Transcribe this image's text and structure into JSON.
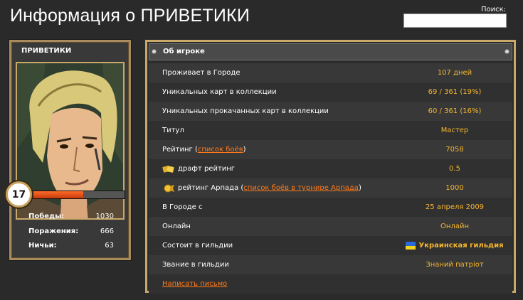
{
  "page": {
    "title": "Информация о ПРИВЕТИКИ",
    "search_label": "Поиск:",
    "search_value": ""
  },
  "profile": {
    "name": "ПРИВЕТИКИ",
    "level": "17",
    "xp_fraction": 0.55,
    "stats": [
      {
        "label": "Победы:",
        "value": "1030"
      },
      {
        "label": "Поражения:",
        "value": "666"
      },
      {
        "label": "Ничьи:",
        "value": "63"
      }
    ]
  },
  "about": {
    "header": "Об игроке",
    "rows": [
      {
        "key": "Проживает в Городе",
        "value": "107 дней"
      },
      {
        "key": "Уникальных карт в коллекции",
        "value": "69 / 361 (19%)"
      },
      {
        "key": "Уникальных прокачанных карт в коллекции",
        "value": "60 / 361 (16%)"
      },
      {
        "key": "Титул",
        "value": "Мастер"
      },
      {
        "key_pre": "Рейтинг (",
        "key_link": "список боёв",
        "key_post": ")",
        "value": "7058"
      },
      {
        "key": "драфт рейтинг",
        "icon": "draft-icon",
        "value": "0.5"
      },
      {
        "key_pre": "рейтинг Арпада (",
        "key_link": "список боёв в турнире Арпада",
        "key_post": ")",
        "icon": "arpad-icon",
        "value": "1000"
      },
      {
        "key": "В Городе с",
        "value": "25 апреля 2009"
      },
      {
        "key": "Онлайн",
        "value": "Онлайн"
      },
      {
        "key": "Состоит в гильдии",
        "value": "Украинская гильдия",
        "icon": "ukraine-flag-icon"
      },
      {
        "key": "Звание в гильдии",
        "value": "Знаний патріот"
      }
    ],
    "write_letter": "Написать письмо"
  },
  "colors": {
    "accent": "#f5b630",
    "link": "#ff7a1a",
    "frame": "#c9a86a"
  }
}
